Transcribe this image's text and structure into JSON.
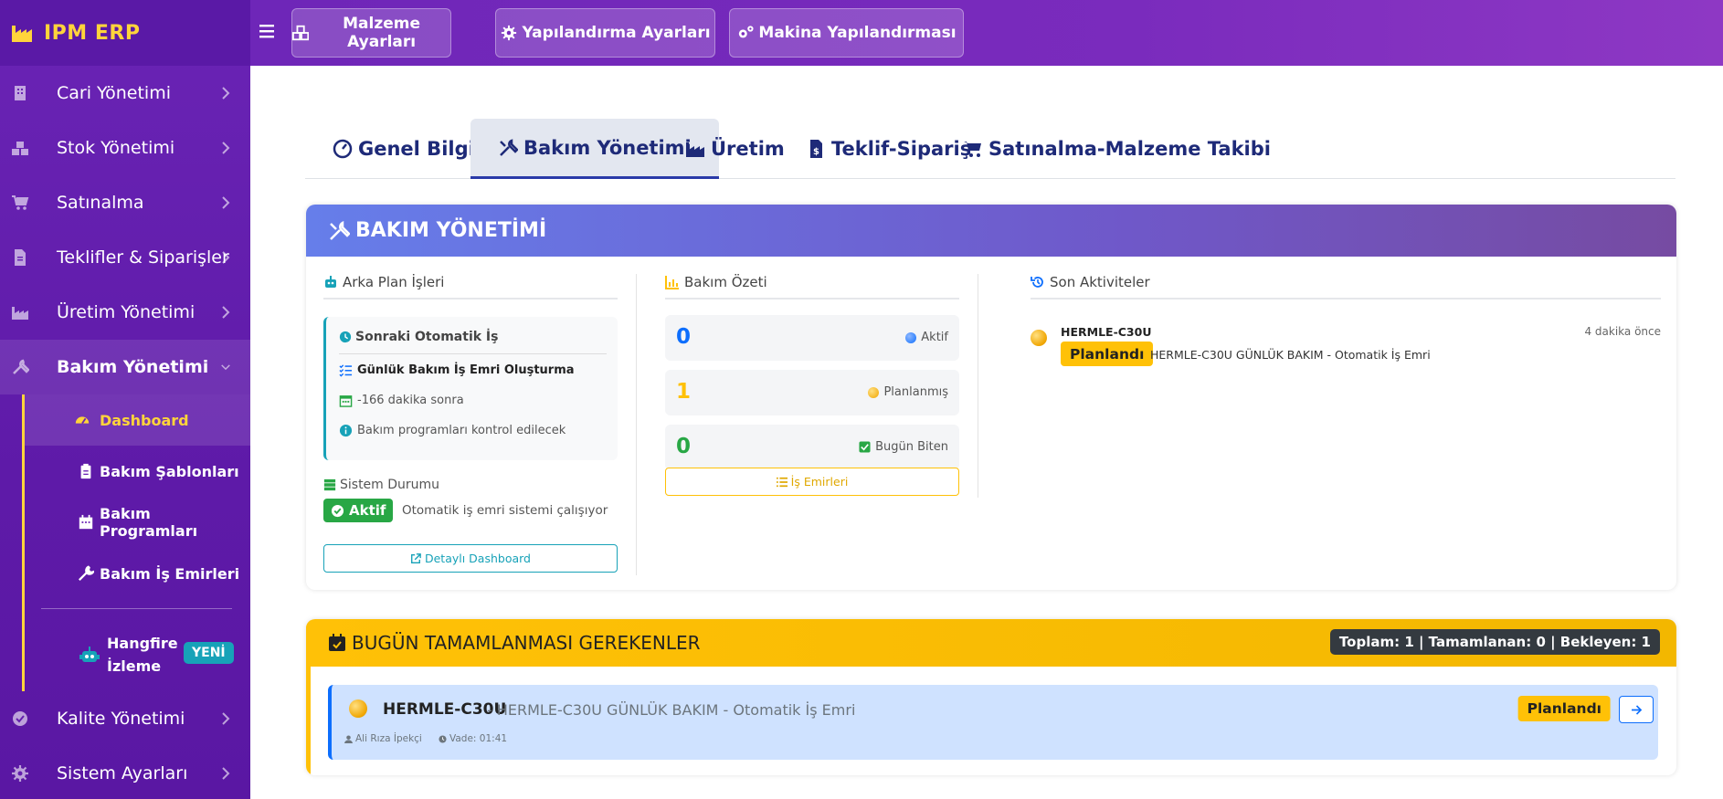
{
  "brand": {
    "name": "IPM ERP"
  },
  "sidebar": {
    "items": [
      {
        "label": "Cari Yönetimi",
        "icon": "building-icon"
      },
      {
        "label": "Stok Yönetimi",
        "icon": "boxes-icon"
      },
      {
        "label": "Satınalma",
        "icon": "cart-icon"
      },
      {
        "label": "Teklifler & Siparişler",
        "icon": "file-invoice-icon"
      },
      {
        "label": "Üretim Yönetimi",
        "icon": "industry-icon"
      },
      {
        "label": "Bakım Yönetimi",
        "icon": "tools-icon"
      },
      {
        "label": "Kalite Yönetimi",
        "icon": "check-circle-icon"
      },
      {
        "label": "Sistem Ayarları",
        "icon": "gear-icon"
      }
    ],
    "sub_items": [
      {
        "label": "Dashboard",
        "icon": "gauge-icon"
      },
      {
        "label": "Bakım Şablonları",
        "icon": "clipboard-icon"
      },
      {
        "label": "Bakım Programları",
        "icon": "calendar-icon"
      },
      {
        "label": "Bakım İş Emirleri",
        "icon": "wrench-icon"
      }
    ],
    "hangfire": {
      "label": "Hangfire İzleme",
      "badge": "YENİ",
      "icon": "robot-icon"
    }
  },
  "topbar": {
    "buttons": [
      "Malzeme Ayarları",
      "Yapılandırma Ayarları",
      "Makina Yapılandırması"
    ]
  },
  "tabs": [
    "Genel Bilgiler",
    "Bakım Yönetimi",
    "Üretim",
    "Teklif-Sipariş",
    "Satınalma-Malzeme Takibi"
  ],
  "maintenance": {
    "title": "BAKIM YÖNETİMİ",
    "background": {
      "title": "Arka Plan İşleri",
      "next_title": "Sonraki Otomatik İş",
      "job_name": "Günlük Bakım İş Emri Oluşturma",
      "time": "-166 dakika sonra",
      "note": "Bakım programları kontrol edilecek",
      "system_label": "Sistem Durumu",
      "status": "Aktif",
      "status_text": "Otomatik iş emri sistemi çalışıyor",
      "detail_button": "Detaylı Dashboard"
    },
    "summary": {
      "title": "Bakım Özeti",
      "items": [
        {
          "value": "0",
          "label": "Aktif",
          "color": "#0d6efd"
        },
        {
          "value": "1",
          "label": "Planlanmış",
          "color": "#ffc107"
        },
        {
          "value": "0",
          "label": "Bugün Biten",
          "color": "#28a745"
        }
      ],
      "button": "İş Emirleri"
    },
    "activities": {
      "title": "Son Aktiviteler",
      "items": [
        {
          "machine": "HERMLE-C30U",
          "time": "4 dakika önce",
          "status": "Planlandı",
          "desc": "HERMLE-C30U GÜNLÜK BAKIM - Otomatik İş Emri"
        }
      ]
    }
  },
  "today": {
    "title": "BUGÜN TAMAMLANMASI GEREKENLER",
    "totals": "Toplam: 1 | Tamamlanan: 0 | Bekleyen: 1",
    "tasks": [
      {
        "machine": "HERMLE-C30U",
        "desc": "- HERMLE-C30U GÜNLÜK BAKIM - Otomatik İş Emri",
        "user": "Ali Rıza İpekçi",
        "due": "Vade: 01:41",
        "status": "Planlandı"
      }
    ]
  },
  "colors": {
    "accent": "#ffd43b",
    "primary_purple": "#6a24b5",
    "warning": "#ffc107",
    "success": "#28a745",
    "info": "#17a2b8"
  }
}
